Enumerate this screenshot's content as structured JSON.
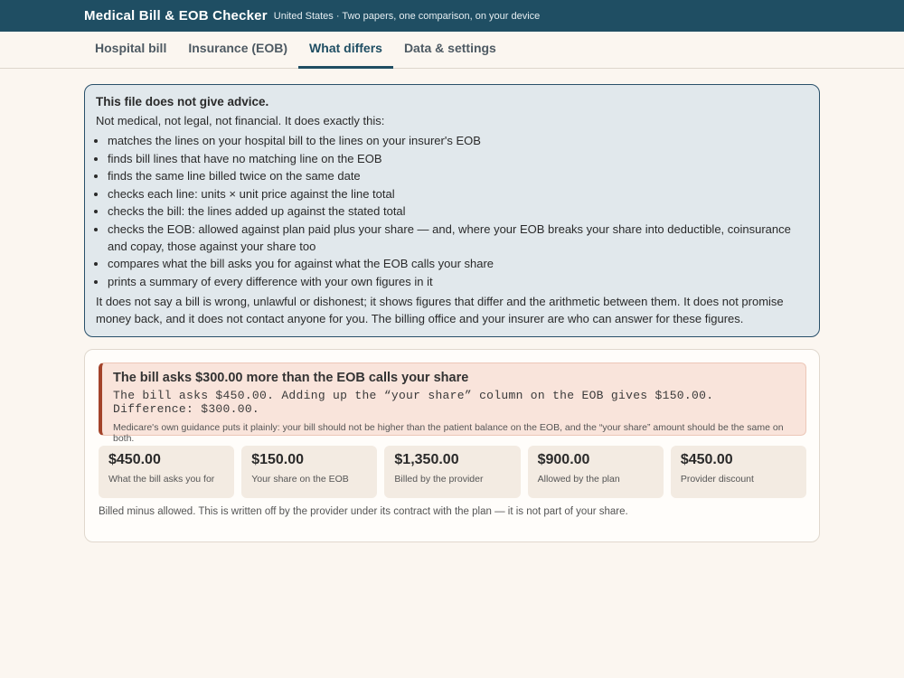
{
  "app": {
    "title": "Medical Bill & EOB Checker",
    "subtitle": "United States · Two papers, one comparison, on your device"
  },
  "tabs": [
    {
      "label": "Hospital bill",
      "active": false
    },
    {
      "label": "Insurance (EOB)",
      "active": false
    },
    {
      "label": "What differs",
      "active": true
    },
    {
      "label": "Data & settings",
      "active": false
    }
  ],
  "notice": {
    "title": "This file does not give advice.",
    "intro": "Not medical, not legal, not financial. It does exactly this:",
    "items": [
      "matches the lines on your hospital bill to the lines on your insurer's EOB",
      "finds bill lines that have no matching line on the EOB",
      "finds the same line billed twice on the same date",
      "checks each line: units × unit price against the line total",
      "checks the bill: the lines added up against the stated total",
      "checks the EOB: allowed against plan paid plus your share — and, where your EOB breaks your share into deductible, coinsurance and copay, those against your share too",
      "compares what the bill asks you for against what the EOB calls your share",
      "prints a summary of every difference with your own figures in it"
    ],
    "footer": "It does not say a bill is wrong, unlawful or dishonest; it shows figures that differ and the arithmetic between them. It does not promise money back, and it does not contact anyone for you. The billing office and your insurer are who can answer for these figures."
  },
  "alert": {
    "title": "The bill asks $300.00 more than the EOB calls your share",
    "detail": "The bill asks $450.00. Adding up the “your share” column on the EOB gives $150.00. Difference: $300.00.",
    "note": "Medicare's own guidance puts it plainly: your bill should not be higher than the patient balance on the EOB, and the “your share” amount should be the same on both.",
    "accent_color": "#a3432a"
  },
  "cards": [
    {
      "value": "$450.00",
      "label": "What the bill asks you for"
    },
    {
      "value": "$150.00",
      "label": "Your share on the EOB"
    },
    {
      "value": "$1,350.00",
      "label": "Billed by the provider"
    },
    {
      "value": "$900.00",
      "label": "Allowed by the plan"
    },
    {
      "value": "$450.00",
      "label": "Provider discount"
    }
  ],
  "footnote": "Billed minus allowed. This is written off by the provider under its contract with the plan — it is not part of your share.",
  "colors": {
    "header_bg": "#1f4e63",
    "notice_bg": "#e1e8ec",
    "page_bg": "#fbf6f0"
  }
}
